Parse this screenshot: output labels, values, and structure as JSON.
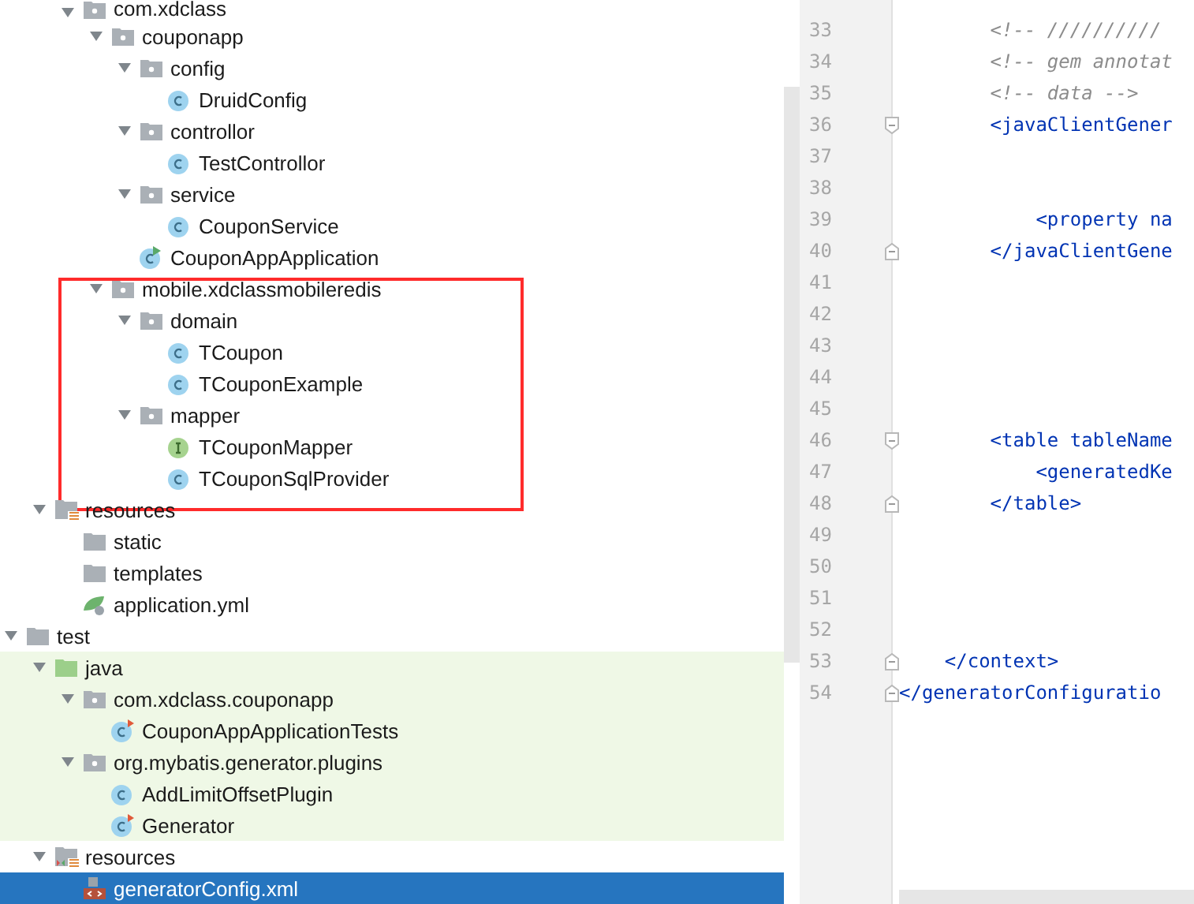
{
  "project_tree": {
    "items": [
      {
        "label": "com.xdclass",
        "kind": "package",
        "expanded": true,
        "selected": false,
        "children": [
          {
            "label": "couponapp",
            "kind": "package",
            "expanded": true,
            "selected": false,
            "children": [
              {
                "label": "config",
                "kind": "package",
                "expanded": true,
                "selected": false,
                "children": [
                  {
                    "label": "DruidConfig",
                    "kind": "class",
                    "selected": false
                  }
                ]
              },
              {
                "label": "controllor",
                "kind": "package",
                "expanded": true,
                "selected": false,
                "children": [
                  {
                    "label": "TestControllor",
                    "kind": "class",
                    "selected": false
                  }
                ]
              },
              {
                "label": "service",
                "kind": "package",
                "expanded": true,
                "selected": false,
                "children": [
                  {
                    "label": "CouponService",
                    "kind": "class",
                    "selected": false
                  }
                ]
              },
              {
                "label": "CouponAppApplication",
                "kind": "app-class",
                "selected": false
              }
            ]
          },
          {
            "label": "mobile.xdclassmobileredis",
            "kind": "package",
            "expanded": true,
            "selected": false,
            "annotated": true,
            "children": [
              {
                "label": "domain",
                "kind": "package",
                "expanded": true,
                "selected": false,
                "children": [
                  {
                    "label": "TCoupon",
                    "kind": "class",
                    "selected": false
                  },
                  {
                    "label": "TCouponExample",
                    "kind": "class",
                    "selected": false
                  }
                ]
              },
              {
                "label": "mapper",
                "kind": "package",
                "expanded": true,
                "selected": false,
                "children": [
                  {
                    "label": "TCouponMapper",
                    "kind": "interface",
                    "selected": false
                  },
                  {
                    "label": "TCouponSqlProvider",
                    "kind": "class",
                    "selected": false
                  }
                ]
              }
            ]
          }
        ]
      },
      {
        "label": "resources",
        "kind": "resources",
        "expanded": true,
        "selected": false,
        "children": [
          {
            "label": "static",
            "kind": "folder",
            "selected": false
          },
          {
            "label": "templates",
            "kind": "folder",
            "selected": false
          },
          {
            "label": "application.yml",
            "kind": "yml",
            "selected": false
          }
        ]
      },
      {
        "label": "test",
        "kind": "folder",
        "expanded": true,
        "selected": false,
        "children": [
          {
            "label": "java",
            "kind": "test-root",
            "expanded": true,
            "selected": false,
            "children": [
              {
                "label": "com.xdclass.couponapp",
                "kind": "package",
                "expanded": true,
                "selected": false,
                "children": [
                  {
                    "label": "CouponAppApplicationTests",
                    "kind": "runnable-class",
                    "selected": false
                  }
                ]
              },
              {
                "label": "org.mybatis.generator.plugins",
                "kind": "package",
                "expanded": true,
                "selected": false,
                "children": [
                  {
                    "label": "AddLimitOffsetPlugin",
                    "kind": "class",
                    "selected": false
                  },
                  {
                    "label": "Generator",
                    "kind": "runnable-class",
                    "selected": false
                  }
                ]
              }
            ]
          },
          {
            "label": "resources",
            "kind": "test-resources",
            "expanded": true,
            "selected": false,
            "children": [
              {
                "label": "generatorConfig.xml",
                "kind": "xml",
                "selected": true
              }
            ]
          }
        ]
      }
    ]
  },
  "editor": {
    "lines": [
      {
        "number": "33",
        "text": "        <!-- //////////",
        "kind": "comment"
      },
      {
        "number": "34",
        "text": "        <!-- gem annotat",
        "kind": "comment"
      },
      {
        "number": "35",
        "text": "        <!-- data -->",
        "kind": "comment"
      },
      {
        "number": "36",
        "text": "        <javaClientGener",
        "kind": "tag",
        "fold_start": true
      },
      {
        "number": "37",
        "kind": "blank"
      },
      {
        "number": "38",
        "kind": "blank"
      },
      {
        "number": "39",
        "text": "            <property na",
        "kind": "tag"
      },
      {
        "number": "40",
        "text": "        </javaClientGene",
        "kind": "tag",
        "fold_end": true
      },
      {
        "number": "41",
        "kind": "blank"
      },
      {
        "number": "42",
        "kind": "blank"
      },
      {
        "number": "43",
        "kind": "blank"
      },
      {
        "number": "44",
        "kind": "blank"
      },
      {
        "number": "45",
        "kind": "blank"
      },
      {
        "number": "46",
        "text": "        <table tableName",
        "kind": "tag",
        "fold_start": true
      },
      {
        "number": "47",
        "text": "            <generatedKe",
        "kind": "tag"
      },
      {
        "number": "48",
        "text": "        </table>",
        "kind": "tag",
        "fold_end": true
      },
      {
        "number": "49",
        "kind": "blank"
      },
      {
        "number": "50",
        "kind": "blank"
      },
      {
        "number": "51",
        "kind": "blank"
      },
      {
        "number": "52",
        "kind": "blank"
      },
      {
        "number": "53",
        "text": "    </context>",
        "kind": "tag",
        "fold_end": true
      },
      {
        "number": "54",
        "text": "</generatorConfiguratio",
        "kind": "tag",
        "fold_end": true
      }
    ]
  }
}
